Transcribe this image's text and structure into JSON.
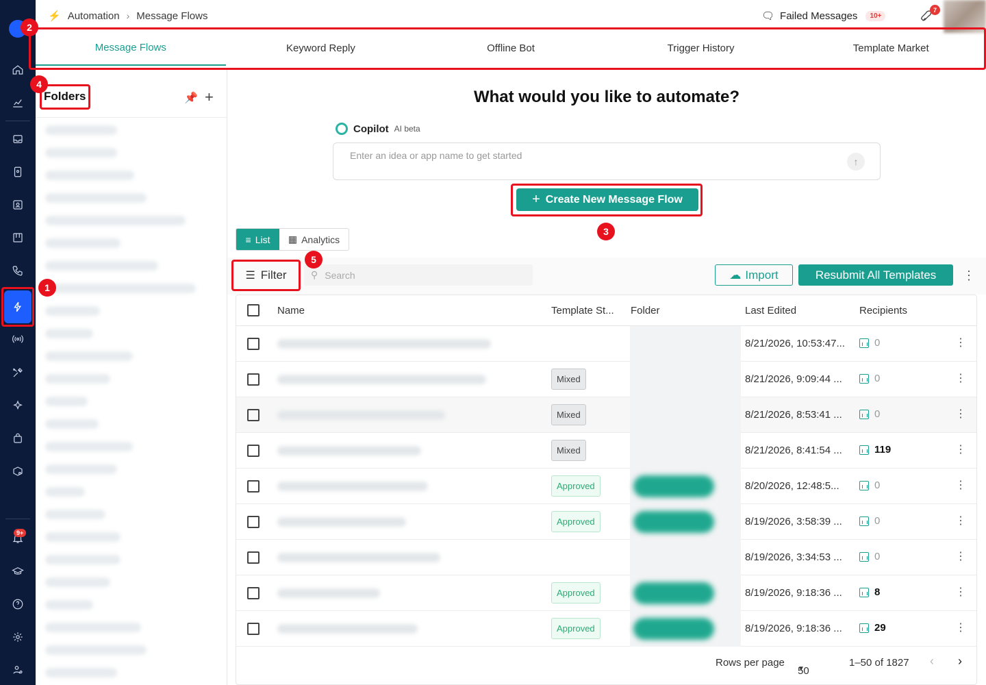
{
  "breadcrumb": {
    "section": "Automation",
    "page": "Message Flows"
  },
  "header": {
    "failed_label": "Failed Messages",
    "failed_count": "10+",
    "rocket_badge": "7"
  },
  "tabs": [
    {
      "label": "Message Flows",
      "active": true
    },
    {
      "label": "Keyword Reply",
      "active": false
    },
    {
      "label": "Offline Bot",
      "active": false
    },
    {
      "label": "Trigger History",
      "active": false
    },
    {
      "label": "Template Market",
      "active": false
    }
  ],
  "folders": {
    "title": "Folders"
  },
  "sidebar": {
    "notification_badge": "9+"
  },
  "main": {
    "headline": "What would you like to automate?",
    "copilot_label": "Copilot",
    "copilot_beta": "AI beta",
    "prompt_placeholder": "Enter an idea or app name to get started",
    "create_button": "Create New Message Flow",
    "view_list": "List",
    "view_analytics": "Analytics",
    "filter_label": "Filter",
    "search_placeholder": "Search",
    "import_label": "Import",
    "resubmit_label": "Resubmit All Templates"
  },
  "table": {
    "columns": [
      "Name",
      "Template St...",
      "Folder",
      "Last Edited",
      "Recipients"
    ],
    "rows": [
      {
        "status": "",
        "last_edited": "8/21/2026, 10:53:47...",
        "recipients": "0"
      },
      {
        "status": "Mixed",
        "last_edited": "8/21/2026, 9:09:44 ...",
        "recipients": "0"
      },
      {
        "status": "Mixed",
        "last_edited": "8/21/2026, 8:53:41 ...",
        "recipients": "0"
      },
      {
        "status": "Mixed",
        "last_edited": "8/21/2026, 8:41:54 ...",
        "recipients": "119"
      },
      {
        "status": "Approved",
        "last_edited": "8/20/2026, 12:48:5...",
        "recipients": "0"
      },
      {
        "status": "Approved",
        "last_edited": "8/19/2026, 3:58:39 ...",
        "recipients": "0"
      },
      {
        "status": "",
        "last_edited": "8/19/2026, 3:34:53 ...",
        "recipients": "0"
      },
      {
        "status": "Approved",
        "last_edited": "8/19/2026, 9:18:36 ...",
        "recipients": "8"
      },
      {
        "status": "Approved",
        "last_edited": "8/19/2026, 9:18:36 ...",
        "recipients": "29"
      }
    ]
  },
  "pagination": {
    "rows_per_page_label": "Rows per page",
    "rows_per_page": "50",
    "range": "1–50 of 1827"
  },
  "annotations": [
    "1",
    "2",
    "3",
    "4",
    "5"
  ],
  "colors": {
    "accent": "#1a9e8f",
    "rail": "#0c1b3a",
    "highlight": "#e8121e",
    "active_rail": "#1e5eff"
  }
}
